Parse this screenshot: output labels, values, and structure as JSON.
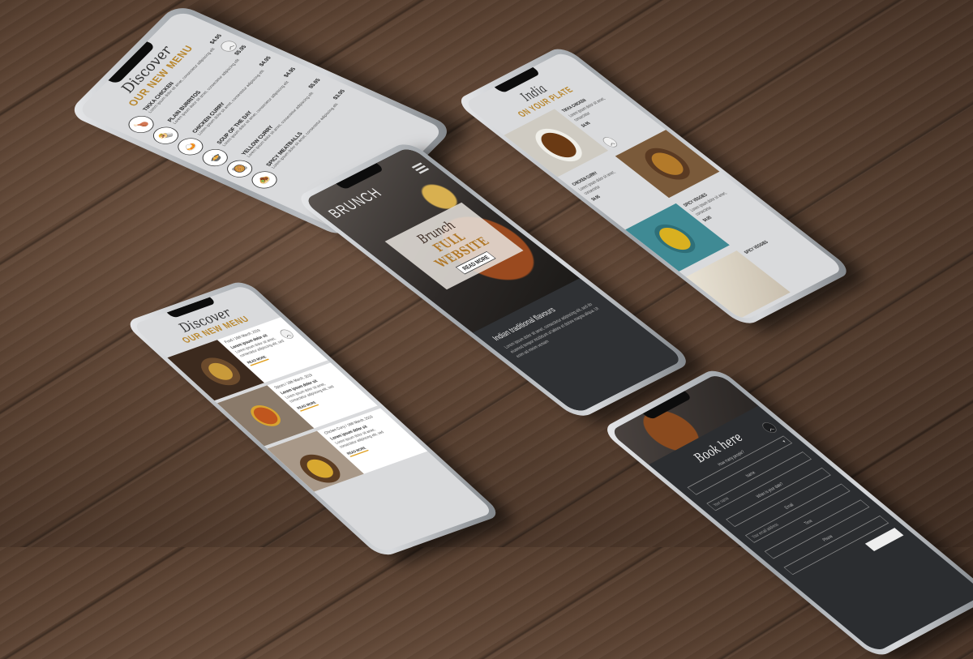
{
  "phone1": {
    "discover": "Discover",
    "our_new_menu": "OUR NEW MENU",
    "items": [
      {
        "name": "TIKKA CHICKEN",
        "desc": "Lorem ipsum dolor sit amet, consectetur adipiscing elit",
        "price": "$4.95",
        "icon": "chicken-leg-icon"
      },
      {
        "name": "PLAIN BURRITOS",
        "desc": "Lorem ipsum dolor sit amet, consectetur adipiscing elit",
        "price": "$5.95",
        "icon": "burrito-icon"
      },
      {
        "name": "CHICKEN CURRY",
        "desc": "Lorem ipsum dolor sit amet, consectetur adipiscing elit",
        "price": "$4.95",
        "icon": "curry-bowl-icon"
      },
      {
        "name": "SOUP OF THE DAY",
        "desc": "Lorem ipsum dolor sit amet, consectetur adipiscing elit",
        "price": "$4.95",
        "icon": "soup-icon"
      },
      {
        "name": "YELLOW CURRY",
        "desc": "Lorem ipsum dolor sit amet, consectetur adipiscing elit",
        "price": "$5.95",
        "icon": "curry-pot-icon"
      },
      {
        "name": "SPICY MEATBALLS",
        "desc": "Lorem ipsum dolor sit amet, consectetur adipiscing elit",
        "price": "$3.95",
        "icon": "meatballs-icon"
      }
    ]
  },
  "phone2": {
    "discover": "Discover",
    "our_new_menu": "OUR NEW MENU",
    "cards": [
      {
        "date": "Food / 16th March, 2019",
        "heading": "Lorem ipsum dolor sit",
        "desc": "Lorem ipsum dolor sit amet, consectetur adipiscing elit, sed",
        "read_more": "READ MORE"
      },
      {
        "date": "Spices / 16th March, 2019",
        "heading": "Lorem ipsum dolor sit",
        "desc": "Lorem ipsum dolor sit amet, consectetur adipiscing elit, sed",
        "read_more": "READ MORE"
      },
      {
        "date": "Chicken Curry / 16th March, 2019",
        "heading": "Lorem ipsum dolor sit",
        "desc": "Lorem ipsum dolor sit amet, consectetur adipiscing elit, sed",
        "read_more": "READ MORE"
      }
    ]
  },
  "phone3": {
    "brand": "BRUNCH",
    "script": "Brunch",
    "headline": "FULL WEBSITE",
    "button": "READ MORE",
    "section_title": "Indian traditional flavours",
    "section_text": "Lorem ipsum dolor sit amet, consectetur adipiscing elit, sed do eiusmod tempor incididunt ut labore et dolore magna aliqua. Ut enim ad minim veniam"
  },
  "phone4": {
    "script": "India",
    "title": "ON YOUR PLATE",
    "items": [
      {
        "name": "TIKKA CHICKEN",
        "desc": "Lorem ipsum dolor sit amet, consectetur",
        "price": "$4.95"
      },
      {
        "name": "CHICKEN CURRY",
        "desc": "Lorem ipsum dolor sit amet, consectetur",
        "price": "$4.95"
      },
      {
        "name": "SPICY VEGGIES",
        "desc": "Lorem ipsum dolor sit amet, consectetur",
        "price": "$4.95"
      },
      {
        "name": "SPICY VEGGIES",
        "desc": "",
        "price": ""
      }
    ]
  },
  "phone5": {
    "title": "Book here",
    "fields": [
      {
        "label": "How many people?",
        "placeholder": "",
        "has_arrow": true
      },
      {
        "label": "Name",
        "placeholder": "Your name",
        "has_arrow": false
      },
      {
        "label": "When is your date?",
        "placeholder": "",
        "has_arrow": false
      },
      {
        "label": "Email",
        "placeholder": "Your email address",
        "has_arrow": false
      },
      {
        "label": "Time",
        "placeholder": "",
        "has_arrow": false
      },
      {
        "label": "Phone",
        "placeholder": "",
        "has_arrow": false
      }
    ]
  },
  "colors": {
    "accent": "#b8862c",
    "readmore_underline": "#e0a020"
  }
}
